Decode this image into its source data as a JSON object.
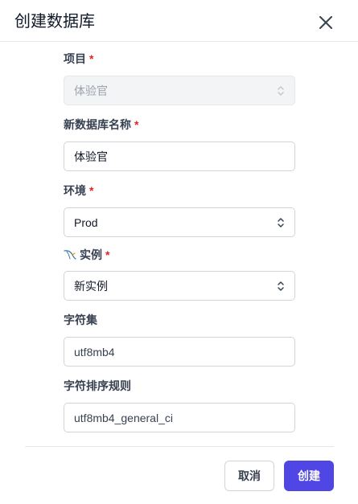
{
  "dialog": {
    "title": "创建数据库",
    "close_icon": "close-icon"
  },
  "fields": {
    "project": {
      "label": "项目",
      "required": "*",
      "value": "体验官"
    },
    "db_name": {
      "label": "新数据库名称",
      "required": "*",
      "value": "体验官"
    },
    "environment": {
      "label": "环境",
      "required": "*",
      "value": "Prod"
    },
    "instance": {
      "label": "实例",
      "required": "*",
      "value": "新实例",
      "icon": "mysql-dolphin-icon"
    },
    "charset": {
      "label": "字符集",
      "value": "utf8mb4"
    },
    "collation": {
      "label": "字符排序规则",
      "value": "utf8mb4_general_ci"
    }
  },
  "footer": {
    "cancel_label": "取消",
    "create_label": "创建"
  },
  "colors": {
    "primary": "#4f46e5",
    "required": "#dc2626"
  }
}
